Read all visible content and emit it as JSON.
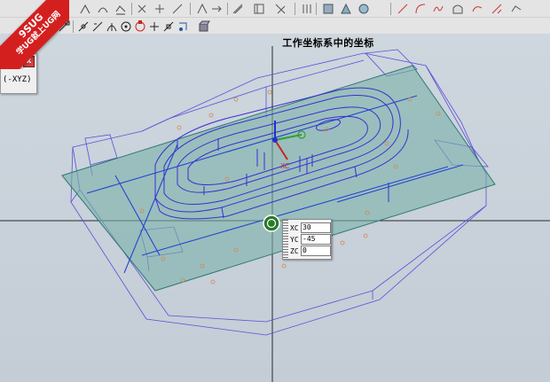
{
  "watermark": {
    "line1": "9SUG",
    "line2": "学UG就上UG网"
  },
  "status": {
    "text": "工作坐标系中的坐标"
  },
  "side_panel": {
    "label": "(-XYZ)",
    "close_glyph": "x"
  },
  "coords": {
    "xc": {
      "label": "XC",
      "value": "30"
    },
    "yc": {
      "label": "YC",
      "value": "-45"
    },
    "zc": {
      "label": "ZC",
      "value": "0"
    }
  },
  "axis_labels": {
    "xc": "XC"
  },
  "colors": {
    "plate_fill": "#79b0a8",
    "plate_edge": "#2e7a73",
    "wire": "#3a2fd0",
    "toolbar": "#e4e4e4",
    "viewport": "#c9d1da",
    "badge": "#d41f1f"
  },
  "toolbar_icons": [
    "sketch-icon",
    "arc-icon",
    "curve-icon",
    "trim-icon",
    "extend-icon",
    "line-icon",
    "point-icon",
    "spline-icon",
    "offset-icon",
    "curve-edit-icon",
    "fillet-icon",
    "chamfer-icon",
    "pattern-icon",
    "mirror-icon",
    "feature-icon",
    "surface-icon",
    "line-tool-icon",
    "arc-tool-icon",
    "spline-tool-icon",
    "bridge-icon",
    "shape-icon",
    "blend-icon"
  ],
  "snap_icons": [
    "endpoint-snap-icon",
    "midpoint-snap-icon",
    "control-point-snap-icon",
    "intersection-snap-icon",
    "center-snap-icon",
    "quadrant-snap-icon",
    "point-on-curve-snap-icon",
    "existing-point-snap-icon",
    "pole-snap-icon",
    "solid-snap-icon"
  ]
}
